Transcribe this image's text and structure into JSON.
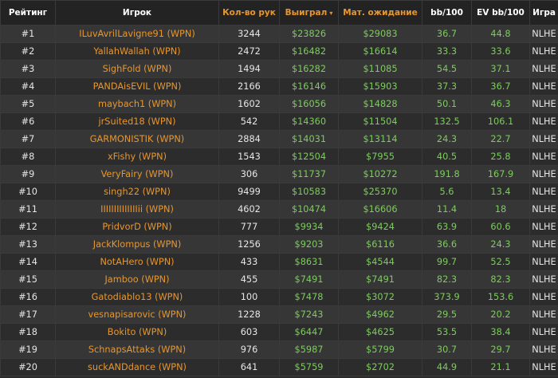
{
  "table": {
    "headers": {
      "rank": "Рейтинг",
      "player": "Игрок",
      "hands": "Кол-во рук",
      "won": "Выиграл",
      "won_sort_icon": "▾",
      "ev": "Мат. ожидание",
      "bb": "bb/100",
      "evbb": "EV bb/100",
      "game": "Игра"
    },
    "rows": [
      {
        "rank": "#1",
        "player": "ILuvAvrilLavigne91 (WPN)",
        "hands": "3244",
        "won": "$23826",
        "ev": "$29083",
        "bb": "36.7",
        "evbb": "44.8",
        "game": "NLHE"
      },
      {
        "rank": "#2",
        "player": "YallahWallah (WPN)",
        "hands": "2472",
        "won": "$16482",
        "ev": "$16614",
        "bb": "33.3",
        "evbb": "33.6",
        "game": "NLHE"
      },
      {
        "rank": "#3",
        "player": "SighFold (WPN)",
        "hands": "1494",
        "won": "$16282",
        "ev": "$11085",
        "bb": "54.5",
        "evbb": "37.1",
        "game": "NLHE"
      },
      {
        "rank": "#4",
        "player": "PANDAisEVIL (WPN)",
        "hands": "2166",
        "won": "$16146",
        "ev": "$15903",
        "bb": "37.3",
        "evbb": "36.7",
        "game": "NLHE"
      },
      {
        "rank": "#5",
        "player": "maybach1 (WPN)",
        "hands": "1602",
        "won": "$16056",
        "ev": "$14828",
        "bb": "50.1",
        "evbb": "46.3",
        "game": "NLHE"
      },
      {
        "rank": "#6",
        "player": "jrSuited18 (WPN)",
        "hands": "542",
        "won": "$14360",
        "ev": "$11504",
        "bb": "132.5",
        "evbb": "106.1",
        "game": "NLHE"
      },
      {
        "rank": "#7",
        "player": "GARMONISTIK (WPN)",
        "hands": "2884",
        "won": "$14031",
        "ev": "$13114",
        "bb": "24.3",
        "evbb": "22.7",
        "game": "NLHE"
      },
      {
        "rank": "#8",
        "player": "xFishy (WPN)",
        "hands": "1543",
        "won": "$12504",
        "ev": "$7955",
        "bb": "40.5",
        "evbb": "25.8",
        "game": "NLHE"
      },
      {
        "rank": "#9",
        "player": "VeryFairy (WPN)",
        "hands": "306",
        "won": "$11737",
        "ev": "$10272",
        "bb": "191.8",
        "evbb": "167.9",
        "game": "NLHE"
      },
      {
        "rank": "#10",
        "player": "singh22 (WPN)",
        "hands": "9499",
        "won": "$10583",
        "ev": "$25370",
        "bb": "5.6",
        "evbb": "13.4",
        "game": "NLHE"
      },
      {
        "rank": "#11",
        "player": "IIIIIIIIIIIIIIii (WPN)",
        "hands": "4602",
        "won": "$10474",
        "ev": "$16606",
        "bb": "11.4",
        "evbb": "18",
        "game": "NLHE"
      },
      {
        "rank": "#12",
        "player": "PridvorD (WPN)",
        "hands": "777",
        "won": "$9934",
        "ev": "$9424",
        "bb": "63.9",
        "evbb": "60.6",
        "game": "NLHE"
      },
      {
        "rank": "#13",
        "player": "JackKlompus (WPN)",
        "hands": "1256",
        "won": "$9203",
        "ev": "$6116",
        "bb": "36.6",
        "evbb": "24.3",
        "game": "NLHE"
      },
      {
        "rank": "#14",
        "player": "NotAHero (WPN)",
        "hands": "433",
        "won": "$8631",
        "ev": "$4544",
        "bb": "99.7",
        "evbb": "52.5",
        "game": "NLHE"
      },
      {
        "rank": "#15",
        "player": "Jamboo (WPN)",
        "hands": "455",
        "won": "$7491",
        "ev": "$7491",
        "bb": "82.3",
        "evbb": "82.3",
        "game": "NLHE"
      },
      {
        "rank": "#16",
        "player": "Gatodiablo13 (WPN)",
        "hands": "100",
        "won": "$7478",
        "ev": "$3072",
        "bb": "373.9",
        "evbb": "153.6",
        "game": "NLHE"
      },
      {
        "rank": "#17",
        "player": "vesnapisarovic (WPN)",
        "hands": "1228",
        "won": "$7243",
        "ev": "$4962",
        "bb": "29.5",
        "evbb": "20.2",
        "game": "NLHE"
      },
      {
        "rank": "#18",
        "player": "Bokito (WPN)",
        "hands": "603",
        "won": "$6447",
        "ev": "$4625",
        "bb": "53.5",
        "evbb": "38.4",
        "game": "NLHE"
      },
      {
        "rank": "#19",
        "player": "SchnapsAttaks (WPN)",
        "hands": "976",
        "won": "$5987",
        "ev": "$5799",
        "bb": "30.7",
        "evbb": "29.7",
        "game": "NLHE"
      },
      {
        "rank": "#20",
        "player": "suckANDdance (WPN)",
        "hands": "641",
        "won": "$5759",
        "ev": "$2702",
        "bb": "44.9",
        "evbb": "21.1",
        "game": "NLHE"
      }
    ]
  }
}
